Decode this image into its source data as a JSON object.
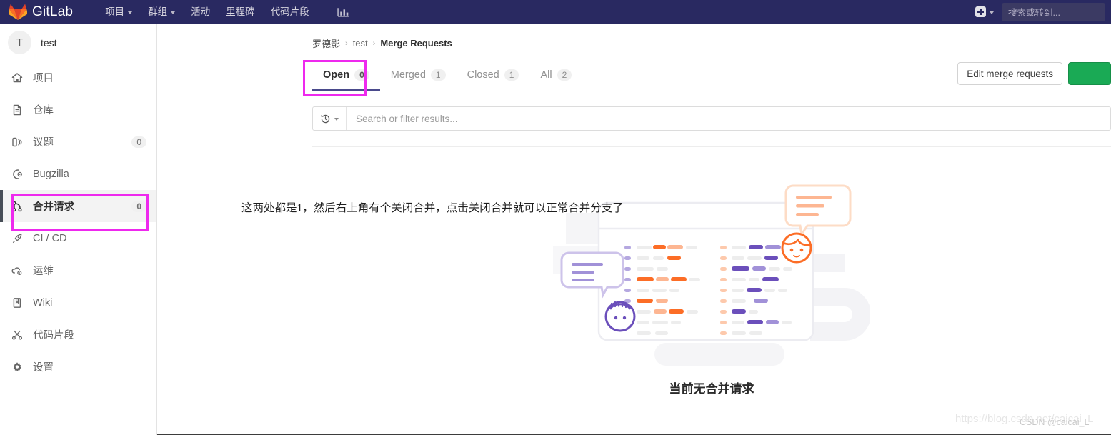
{
  "topnav": {
    "brand": "GitLab",
    "logo_icon": "gitlab-fox-logo",
    "links": [
      {
        "label": "项目",
        "icon": "chevron-down-icon",
        "has_caret": true
      },
      {
        "label": "群组",
        "icon": "chevron-down-icon",
        "has_caret": true
      },
      {
        "label": "活动",
        "has_caret": false
      },
      {
        "label": "里程碑",
        "has_caret": false
      },
      {
        "label": "代码片段",
        "has_caret": false
      }
    ],
    "analytics_icon": "chart-icon",
    "plus_icon": "plus-square-icon",
    "plus_caret_icon": "chevron-down-icon",
    "search_placeholder": "搜索或转到..."
  },
  "sidebar": {
    "project": {
      "avatar_letter": "T",
      "name": "test"
    },
    "items": [
      {
        "label": "项目",
        "icon": "home-icon",
        "count": "",
        "active": false
      },
      {
        "label": "仓库",
        "icon": "document-icon",
        "count": "",
        "active": false
      },
      {
        "label": "议题",
        "icon": "issues-icon",
        "count": "0",
        "active": false
      },
      {
        "label": "Bugzilla",
        "icon": "bug-gear-icon",
        "count": "",
        "active": false
      },
      {
        "label": "合并请求",
        "icon": "merge-request-icon",
        "count": "0",
        "active": true
      },
      {
        "label": "CI / CD",
        "icon": "rocket-icon",
        "count": "",
        "active": false
      },
      {
        "label": "运维",
        "icon": "cloud-gear-icon",
        "count": "",
        "active": false
      },
      {
        "label": "Wiki",
        "icon": "book-icon",
        "count": "",
        "active": false
      },
      {
        "label": "代码片段",
        "icon": "scissors-icon",
        "count": "",
        "active": false
      },
      {
        "label": "设置",
        "icon": "gear-icon",
        "count": "",
        "active": false
      }
    ]
  },
  "breadcrumb": {
    "owner": "罗德影",
    "project": "test",
    "current": "Merge Requests",
    "separator": "›"
  },
  "tabs": [
    {
      "label": "Open",
      "count": "0",
      "active": true
    },
    {
      "label": "Merged",
      "count": "1",
      "active": false
    },
    {
      "label": "Closed",
      "count": "1",
      "active": false
    },
    {
      "label": "All",
      "count": "2",
      "active": false
    }
  ],
  "actions": {
    "edit_label": "Edit merge requests",
    "new_button_color": "#1aaa55"
  },
  "filter": {
    "history_icon": "history-icon",
    "caret_icon": "chevron-down-icon",
    "placeholder": "Search or filter results..."
  },
  "annotation": {
    "text": "这两处都是1，然后右上角有个关闭合并，点击关闭合并就可以正常合并分支了",
    "box_color": "#ee29ee"
  },
  "empty_state": {
    "illustration": "merge-request-empty-illustration",
    "title": "当前无合并请求"
  },
  "watermark": {
    "url": "https://blog.csdn.net/caicai_L",
    "credit": "CSDN @caicai_L"
  },
  "colors": {
    "navbar": "#292961",
    "active_tab_underline": "#4a4a8c",
    "sidebar_active_bar": "#474d57",
    "annotation": "#ee29ee",
    "green": "#1aaa55"
  }
}
